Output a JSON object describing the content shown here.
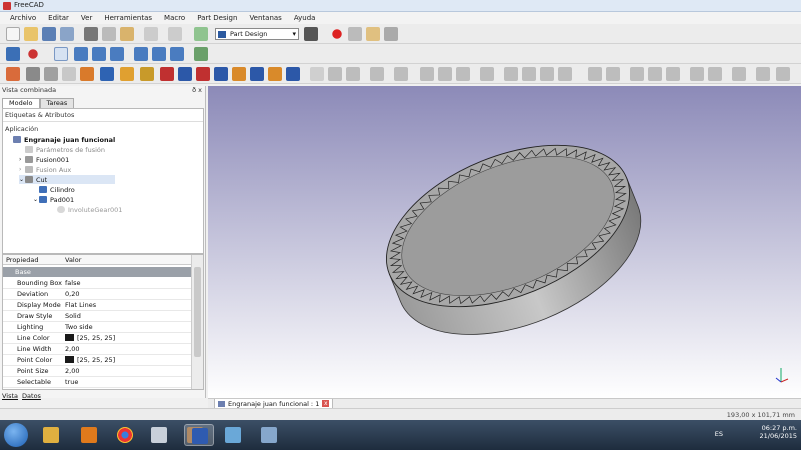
{
  "window": {
    "title": "FreeCAD"
  },
  "menu": [
    "Archivo",
    "Editar",
    "Ver",
    "Herramientas",
    "Macro",
    "Part Design",
    "Ventanas",
    "Ayuda"
  ],
  "toolbar": {
    "workbench": "Part Design"
  },
  "combo": {
    "title": "Vista combinada",
    "pin": "ð x",
    "tabs": [
      "Modelo",
      "Tareas"
    ],
    "section": "Etiquetas & Atributos",
    "app_label": "Aplicación",
    "tree": [
      {
        "label": "Engranaje juan funcional",
        "bold": true
      },
      {
        "label": "Parámetros de fusión"
      },
      {
        "label": "Fusion001"
      },
      {
        "label": "Fusion Aux"
      },
      {
        "label": "Cut",
        "selected": true
      },
      {
        "label": "Cilindro"
      },
      {
        "label": "Pad001"
      },
      {
        "label": "InvoluteGear001"
      }
    ]
  },
  "properties": {
    "col_name": "Propiedad",
    "col_value": "Valor",
    "group": "Base",
    "rows": [
      {
        "name": "Bounding Box",
        "value": "false"
      },
      {
        "name": "Deviation",
        "value": "0,20"
      },
      {
        "name": "Display Mode",
        "value": "Flat Lines"
      },
      {
        "name": "Draw Style",
        "value": "Solid"
      },
      {
        "name": "Lighting",
        "value": "Two side"
      },
      {
        "name": "Line Color",
        "value": "[25, 25, 25]",
        "swatch": true
      },
      {
        "name": "Line Width",
        "value": "2,00"
      },
      {
        "name": "Point Color",
        "value": "[25, 25, 25]",
        "swatch": true
      },
      {
        "name": "Point Size",
        "value": "2,00"
      },
      {
        "name": "Selectable",
        "value": "true"
      }
    ]
  },
  "bottom_tabs": [
    "Vista",
    "Datos"
  ],
  "document_tab": {
    "label": "Engranaje juan funcional : 1",
    "close": "x"
  },
  "status": {
    "coords": "193,00 x 101,71 mm"
  },
  "tray": {
    "lang": "ES",
    "time": "06:27 p.m.",
    "date": "21/06/2015"
  },
  "colors": {
    "view_top": "#8c8ab8",
    "view_bottom": "#ffffff",
    "group_bar": "#9aa0a8",
    "selection": "#dbe6f5"
  }
}
